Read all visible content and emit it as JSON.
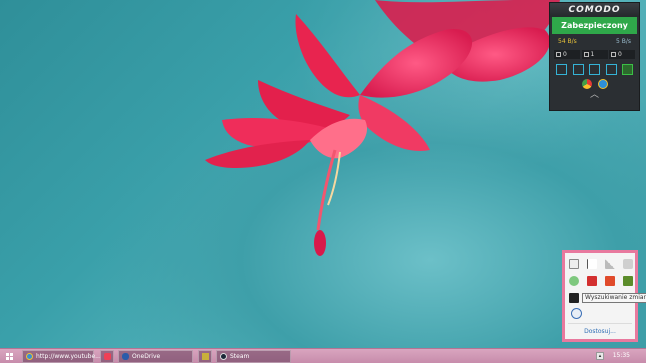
{
  "comodo": {
    "brand": "COMODO",
    "status": "Zabezpieczony",
    "rate_down": "54 B/s",
    "rate_up": "5 B/s",
    "counts": [
      "0",
      "1",
      "0"
    ],
    "status_color": "#2fa84a"
  },
  "tray": {
    "tooltip": "Wyszukiwanie zmian",
    "customize_link": "Dostosuj..."
  },
  "taskbar": {
    "items": [
      {
        "label": "http://www.youtube...",
        "icon": "ie-icon"
      },
      {
        "label": "",
        "icon": "pocket-icon"
      },
      {
        "label": "OneDrive",
        "icon": "onedrive-icon"
      },
      {
        "label": "",
        "icon": "media-player-icon"
      },
      {
        "label": "Steam",
        "icon": "steam-icon"
      }
    ],
    "clock": "15:35",
    "tray_arrow": "▴"
  },
  "colors": {
    "accent_pink": "#e8799e",
    "taskbar": "#c78cab",
    "wallpaper": "#3aa0aa"
  }
}
